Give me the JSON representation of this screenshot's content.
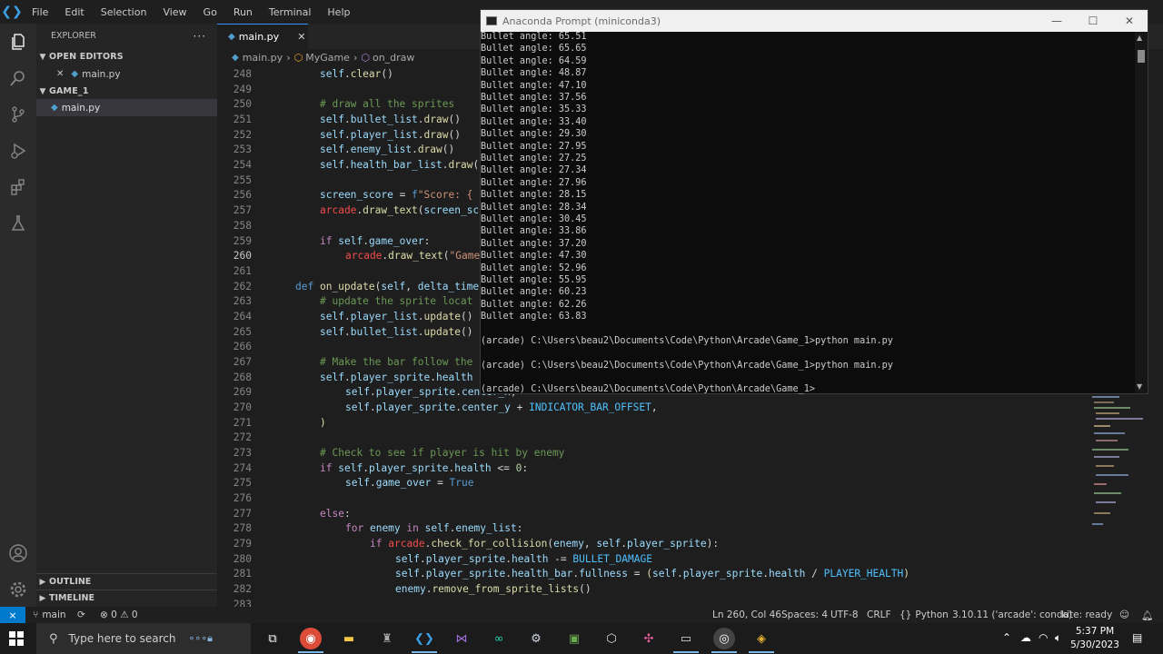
{
  "menu": [
    "File",
    "Edit",
    "Selection",
    "View",
    "Go",
    "Run",
    "Terminal",
    "Help"
  ],
  "sidebar": {
    "title": "EXPLORER",
    "more": "···",
    "open_editors": "OPEN EDITORS",
    "open_file": "main.py",
    "folder": "GAME_1",
    "folder_file": "main.py",
    "outline": "OUTLINE",
    "timeline": "TIMELINE"
  },
  "tab": {
    "label": "main.py",
    "close": "✕"
  },
  "breadcrumb": {
    "file": "main.py",
    "class": "MyGame",
    "method": "on_draw"
  },
  "editor": {
    "cursor_line": 260,
    "lines": [
      {
        "n": 248
      },
      {
        "n": 249
      },
      {
        "n": 250
      },
      {
        "n": 251
      },
      {
        "n": 252
      },
      {
        "n": 253
      },
      {
        "n": 254
      },
      {
        "n": 255
      },
      {
        "n": 256
      },
      {
        "n": 257
      },
      {
        "n": 258
      },
      {
        "n": 259
      },
      {
        "n": 260
      },
      {
        "n": 261
      },
      {
        "n": 262
      },
      {
        "n": 263
      },
      {
        "n": 264
      },
      {
        "n": 265
      },
      {
        "n": 266
      },
      {
        "n": 267
      },
      {
        "n": 268
      },
      {
        "n": 269
      },
      {
        "n": 270
      },
      {
        "n": 271
      },
      {
        "n": 272
      },
      {
        "n": 273
      },
      {
        "n": 274
      },
      {
        "n": 275
      },
      {
        "n": 276
      },
      {
        "n": 277
      },
      {
        "n": 278
      },
      {
        "n": 279
      },
      {
        "n": 280
      },
      {
        "n": 281
      },
      {
        "n": 282
      },
      {
        "n": 283
      }
    ]
  },
  "terminal": {
    "title": "Anaconda Prompt (miniconda3)",
    "angles": [
      "65.51",
      "65.65",
      "64.59",
      "48.87",
      "47.10",
      "37.56",
      "35.33",
      "33.40",
      "29.30",
      "27.95",
      "27.25",
      "27.34",
      "27.96",
      "28.15",
      "28.34",
      "30.45",
      "33.86",
      "37.20",
      "47.30",
      "52.96",
      "55.95",
      "60.23",
      "62.26",
      "63.83"
    ],
    "angle_prefix": "Bullet angle: ",
    "prompt1": "(arcade) C:\\Users\\beau2\\Documents\\Code\\Python\\Arcade\\Game_1>python main.py",
    "prompt2": "(arcade) C:\\Users\\beau2\\Documents\\Code\\Python\\Arcade\\Game_1>python main.py",
    "prompt3": "(arcade) C:\\Users\\beau2\\Documents\\Code\\Python\\Arcade\\Game_1>"
  },
  "status": {
    "branch": "main",
    "problems": "⊗ 0 ⚠ 0",
    "position": "Ln 260, Col 46",
    "spaces": "Spaces: 4",
    "encoding": "UTF-8",
    "eol": "CRLF",
    "language": "Python",
    "interpreter": "3.10.11 ('arcade': conda)",
    "kite": "kite: ready"
  },
  "taskbar": {
    "search_placeholder": "Type here to search",
    "time": "5:37 PM",
    "date": "5/30/2023"
  }
}
